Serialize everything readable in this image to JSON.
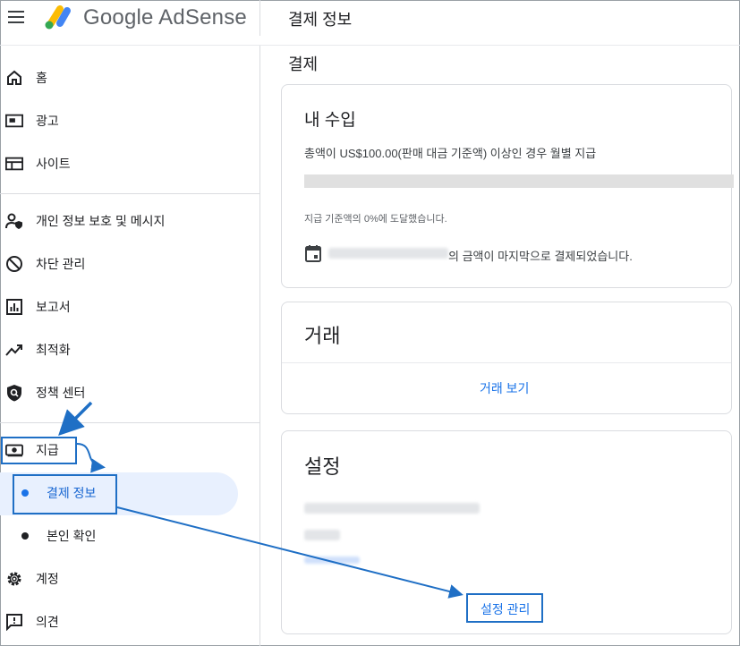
{
  "header": {
    "brand": "Google AdSense",
    "page_title": "결제 정보"
  },
  "sidebar": {
    "items": [
      {
        "label": "홈",
        "icon": "home-icon"
      },
      {
        "label": "광고",
        "icon": "ads-icon"
      },
      {
        "label": "사이트",
        "icon": "sites-icon"
      },
      {
        "label": "개인 정보 보호 및 메시지",
        "icon": "privacy-icon"
      },
      {
        "label": "차단 관리",
        "icon": "block-icon"
      },
      {
        "label": "보고서",
        "icon": "reports-icon"
      },
      {
        "label": "최적화",
        "icon": "optimize-icon"
      },
      {
        "label": "정책 센터",
        "icon": "policy-shield-icon"
      },
      {
        "label": "지급",
        "icon": "payments-icon"
      },
      {
        "label": "계정",
        "icon": "gear-icon"
      },
      {
        "label": "의견",
        "icon": "feedback-icon"
      }
    ],
    "sub_items": [
      {
        "label": "결제 정보",
        "active": true
      },
      {
        "label": "본인 확인",
        "active": false
      }
    ]
  },
  "main": {
    "section_title": "결제",
    "earnings_card": {
      "title": "내 수입",
      "threshold_text": "총액이 US$100.00(판매 대금 기준액) 이상인 경우 월별 지급",
      "progress_percent": 0,
      "progress_caption": "지급 기준액의 0%에 도달했습니다.",
      "last_payment_text": "의 금액이 마지막으로 결제되었습니다."
    },
    "transactions_card": {
      "title": "거래",
      "link": "거래 보기"
    },
    "settings_card": {
      "title": "설정",
      "link": "설정 관리"
    }
  },
  "colors": {
    "accent": "#1a73e8",
    "annotation": "#1f6fc5",
    "active_bg": "#e8f0fe"
  }
}
